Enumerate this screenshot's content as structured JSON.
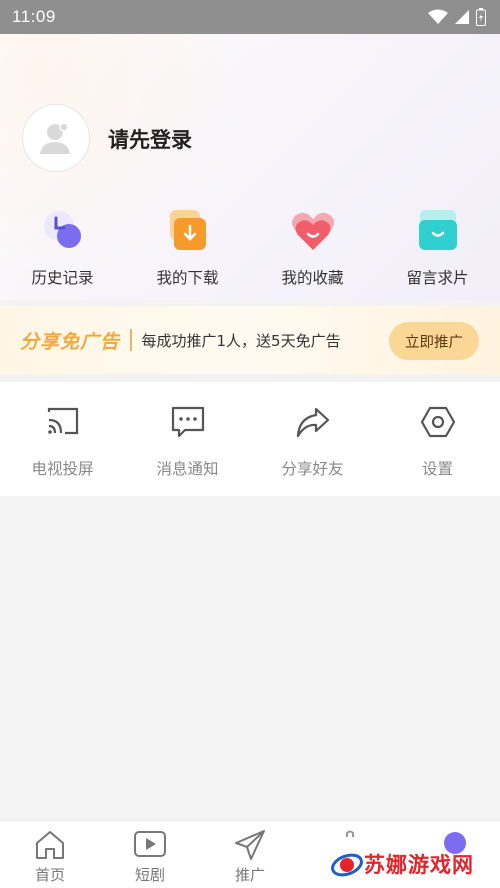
{
  "status_bar": {
    "time": "11:09",
    "icons": [
      "wifi-icon",
      "signal-icon",
      "battery-icon"
    ]
  },
  "profile": {
    "login_prompt": "请先登录",
    "avatar_icon": "user-avatar-icon"
  },
  "quick_actions": [
    {
      "label": "历史记录",
      "icon": "history-icon",
      "color": "#8b7cf6"
    },
    {
      "label": "我的下载",
      "icon": "download-icon",
      "color": "#f7a23c"
    },
    {
      "label": "我的收藏",
      "icon": "heart-icon",
      "color": "#f25d6a"
    },
    {
      "label": "留言求片",
      "icon": "message-box-icon",
      "color": "#2fd0cf"
    }
  ],
  "banner": {
    "brand": "分享免广告",
    "text": "每成功推广1人，送5天免广告",
    "button": "立即推广",
    "accent": "#f7a83c"
  },
  "tools": [
    {
      "label": "电视投屏",
      "icon": "cast-icon"
    },
    {
      "label": "消息通知",
      "icon": "message-icon"
    },
    {
      "label": "分享好友",
      "icon": "share-icon"
    },
    {
      "label": "设置",
      "icon": "settings-icon"
    }
  ],
  "tabbar": [
    {
      "label": "首页",
      "icon": "home-icon"
    },
    {
      "label": "短剧",
      "icon": "play-icon"
    },
    {
      "label": "推广",
      "icon": "send-icon"
    },
    {
      "label": "",
      "icon": "bag-icon"
    },
    {
      "label": "",
      "icon": "profile-icon"
    }
  ],
  "watermark": {
    "text": "苏娜游戏网",
    "logo": "watermark-logo-icon"
  }
}
